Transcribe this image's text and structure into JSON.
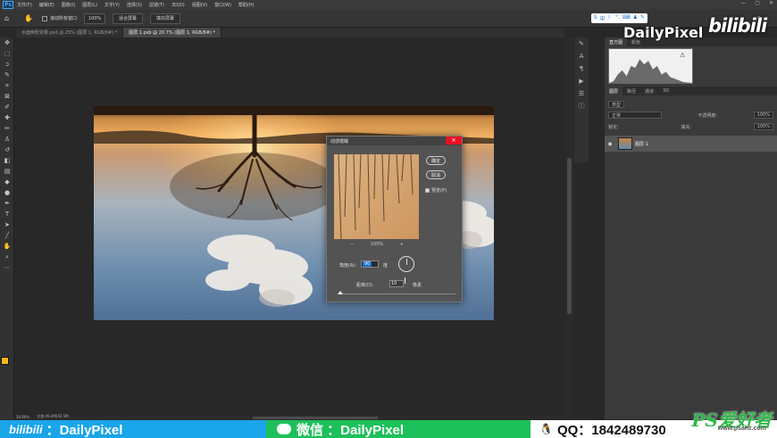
{
  "menubar": {
    "logo": "Ps",
    "items": [
      "文件(F)",
      "编辑(E)",
      "图像(I)",
      "图层(L)",
      "文字(Y)",
      "选择(S)",
      "滤镜(T)",
      "3D(D)",
      "视图(V)",
      "窗口(W)",
      "帮助(H)"
    ],
    "window_controls": [
      "—",
      "▢",
      "✕"
    ]
  },
  "optionsbar": {
    "scroll_all_label": "滚动所有窗口",
    "zoom_value": "100%",
    "fit_screen": "适合屏幕",
    "fill_screen": "填充屏幕"
  },
  "tabs": [
    {
      "label": "水面倒影效果.psd @ 25% (图层 1, RGB/8#) *",
      "active": false
    },
    {
      "label": "图层 1.psb @ 20.7% (图层 1, RGB/8#) *",
      "active": true
    }
  ],
  "status": {
    "zoom": "20.66%",
    "doc": "文档:49.4M/42.5M"
  },
  "dialog": {
    "title": "动感模糊",
    "close": "✕",
    "ok": "确定",
    "cancel": "取消",
    "preview": "预览(P)",
    "zoom_level": "100%",
    "zoom_out": "−",
    "zoom_in": "+",
    "angle_label": "角度(A):",
    "angle_value": "90",
    "angle_unit": "度",
    "distance_label": "距离(D):",
    "distance_value": "10",
    "distance_unit": "像素",
    "slider_fraction": 0.0
  },
  "panels": {
    "top_tabs": [
      "直方图",
      "颜色"
    ],
    "layers_tabs": [
      "图层",
      "路径",
      "通道",
      "3D"
    ],
    "filter_kind": "类型",
    "blend_mode": "正常",
    "opacity_label": "不透明度:",
    "opacity_value": "100%",
    "lock_label": "锁定:",
    "fill_label": "填充:",
    "fill_value": "100%",
    "layer_name": "图层 1",
    "warning": "⚠"
  },
  "watermark": {
    "channel": "DailyPixel",
    "bili": "bilibili"
  },
  "banner": {
    "bili_logo": "bilibili",
    "bili_text": "：DailyPixel",
    "wechat_text": "微信 ：DailyPixel",
    "qq_text": "QQ：1842489730",
    "site_logo": "PS爱好者",
    "site_url": "www.psahz.com"
  },
  "colors": {
    "foreground": "#f7b715",
    "banner_blue": "#1aa5e8",
    "banner_green": "#1dc05a",
    "close_red": "#e81123"
  }
}
